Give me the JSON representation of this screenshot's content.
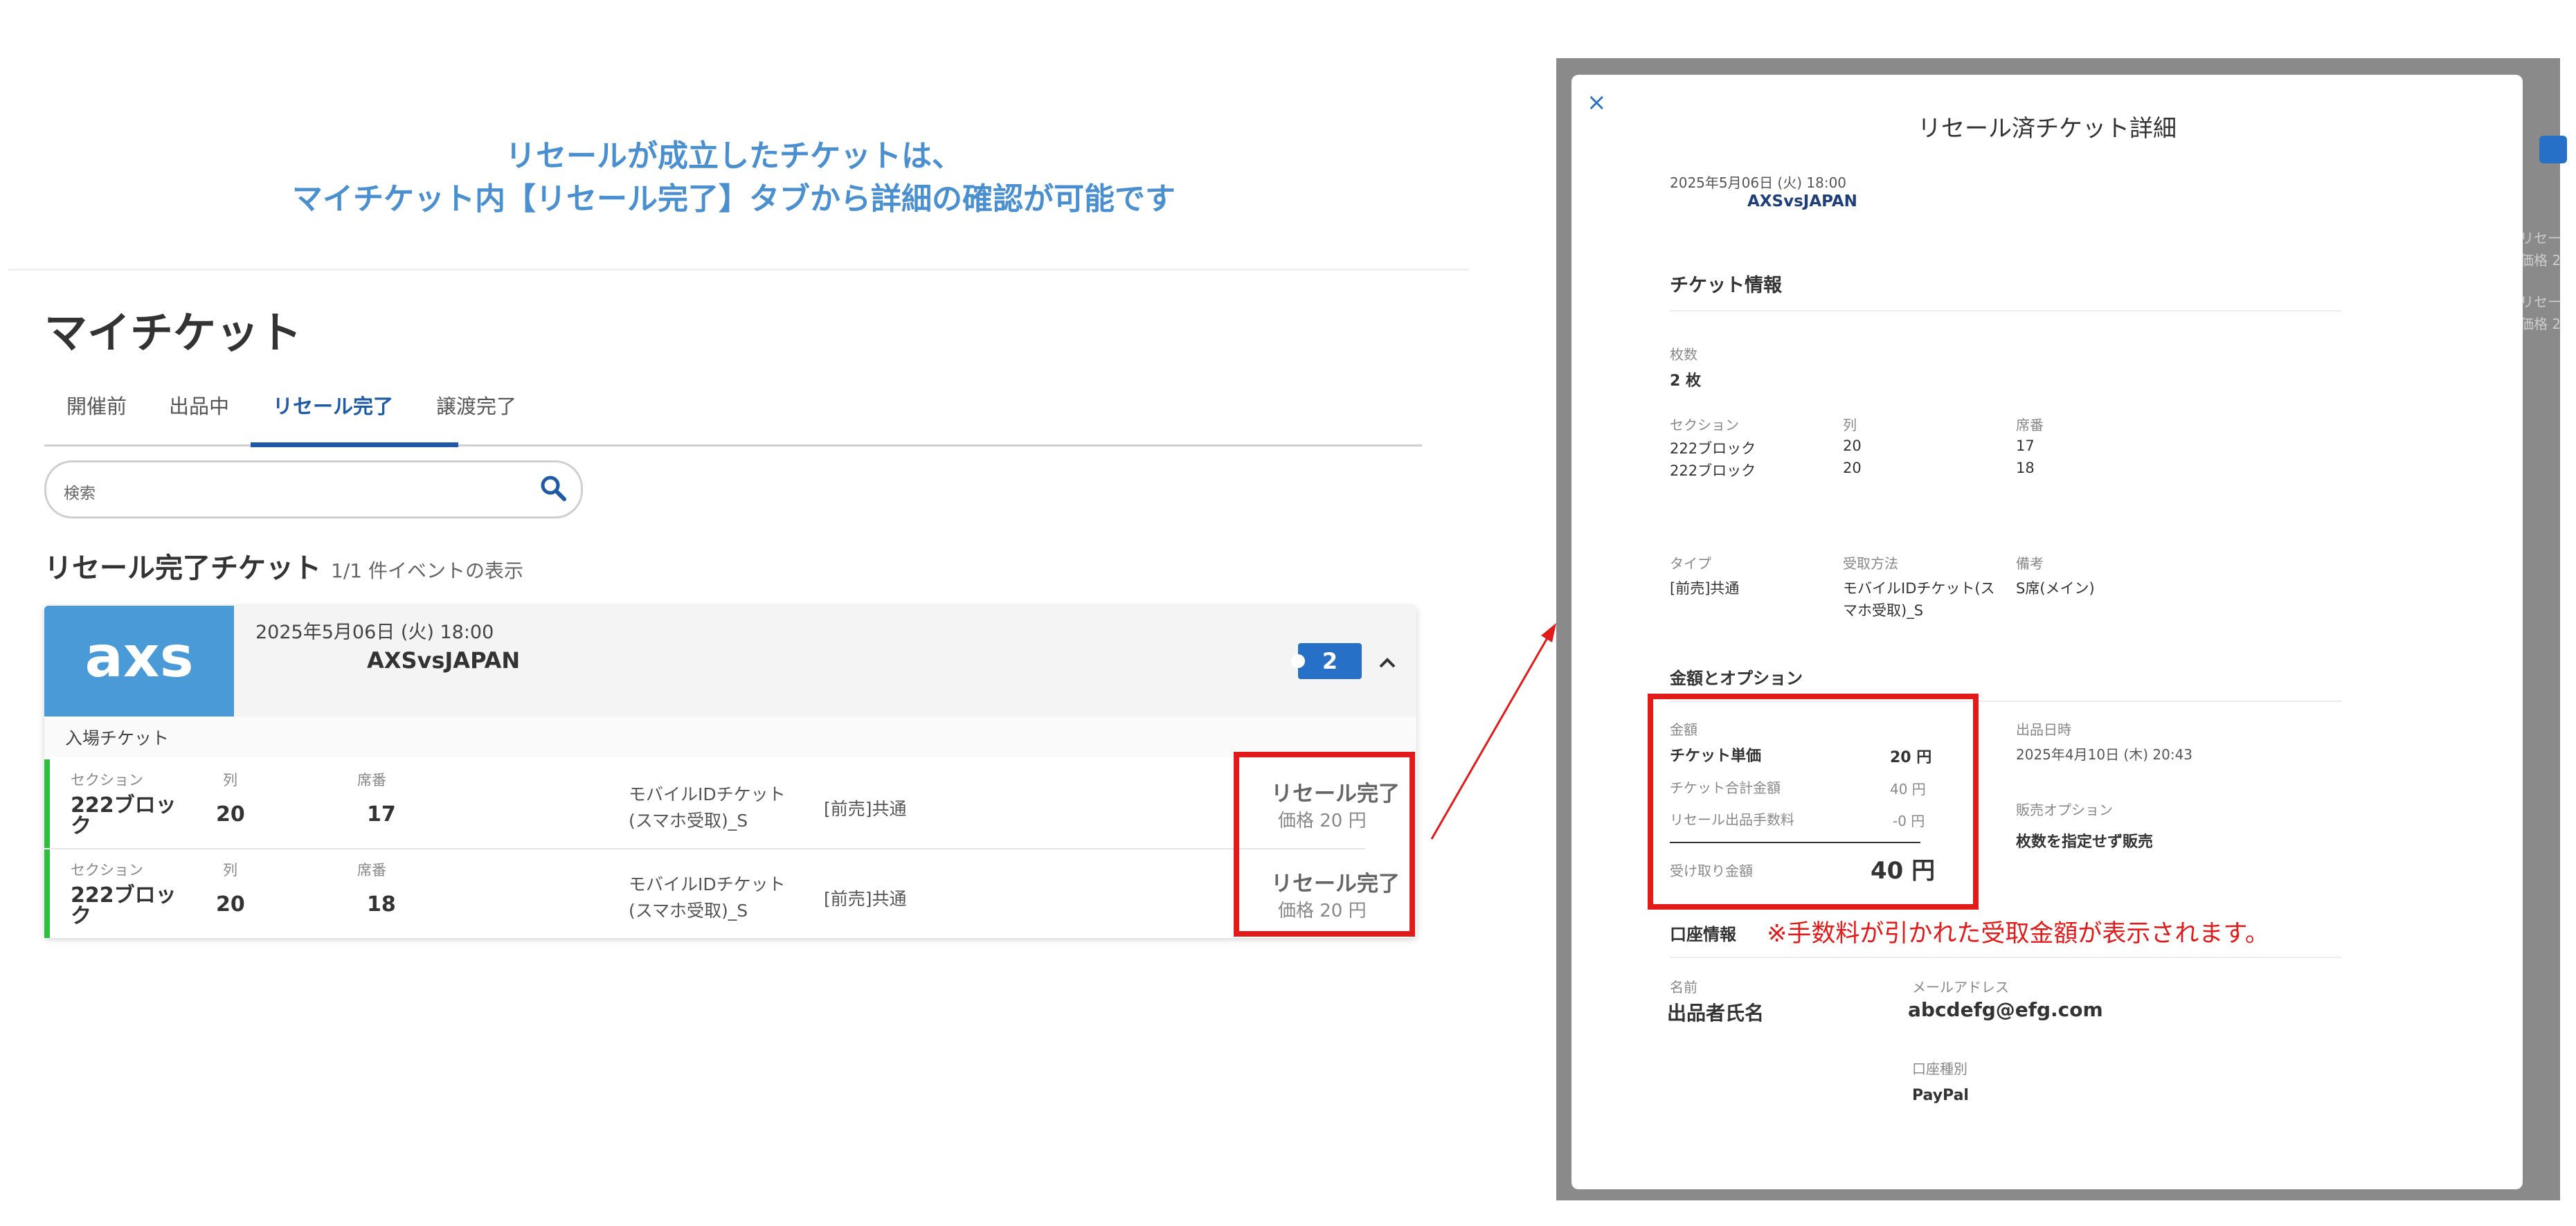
{
  "caption": {
    "line1": "リセールが成立したチケットは、",
    "line2": "マイチケット内【リセール完了】タブから詳細の確認が可能です"
  },
  "page": {
    "title": "マイチケット",
    "tabs": [
      {
        "label": "開催前"
      },
      {
        "label": "出品中"
      },
      {
        "label": "リセール完了"
      },
      {
        "label": "譲渡完了"
      }
    ],
    "active_tab": "リセール完了",
    "search_placeholder": "検索",
    "section_title": "リセール完了チケット",
    "section_count": "1/1 件イベントの表示"
  },
  "event": {
    "logo": "axs",
    "date": "2025年5月06日 (火) 18:00",
    "name": "AXSvsJAPAN",
    "qty": "2",
    "entry_label": "入場チケット"
  },
  "tickets": [
    {
      "section_label": "セクション",
      "section": "222ブロック",
      "row_label": "列",
      "row": "20",
      "seat_label": "席番",
      "seat": "17",
      "delivery": "モバイルIDチケット(スマホ受取)_S",
      "type": "[前売]共通",
      "status": "リセール完了",
      "price": "価格 20 円"
    },
    {
      "section_label": "セクション",
      "section": "222ブロック",
      "row_label": "列",
      "row": "20",
      "seat_label": "席番",
      "seat": "18",
      "delivery": "モバイルIDチケット(スマホ受取)_S",
      "type": "[前売]共通",
      "status": "リセール完了",
      "price": "価格 20 円"
    }
  ],
  "background_peek": {
    "line1": "リセー",
    "line2": "価格 2",
    "line3": "リセー",
    "line4": "価格 2"
  },
  "modal": {
    "close_icon": "×",
    "title": "リセール済チケット詳細",
    "event_date": "2025年5月06日 (火) 18:00",
    "event_name": "AXSvsJAPAN",
    "ticket_info_title": "チケット情報",
    "count_label": "枚数",
    "count_value": "2 枚",
    "section_label": "セクション",
    "row_label": "列",
    "seat_label": "席番",
    "seats": [
      {
        "section": "222ブロック",
        "row": "20",
        "seat": "17"
      },
      {
        "section": "222ブロック",
        "row": "20",
        "seat": "18"
      }
    ],
    "type_label": "タイプ",
    "type_value": "[前売]共通",
    "receive_label": "受取方法",
    "receive_value": "モバイルIDチケット(スマホ受取)_S",
    "note_label": "備考",
    "note_value": "S席(メイン)",
    "amount_title": "金額とオプション",
    "amount_label": "金額",
    "unit_price_label": "チケット単価",
    "unit_price_value": "20 円",
    "total_label": "チケット合計金額",
    "total_value": "40 円",
    "fee_label": "リセール出品手数料",
    "fee_value": "-0 円",
    "receive_amount_label": "受け取り金額",
    "receive_amount_value": "40 円",
    "listed_date_label": "出品日時",
    "listed_date_value": "2025年4月10日 (木) 20:43",
    "sale_option_label": "販売オプション",
    "sale_option_value": "枚数を指定せず販売",
    "account_title": "口座情報",
    "annotation": "※手数料が引かれた受取金額が表示されます。",
    "name_label": "名前",
    "name_value": "出品者氏名",
    "email_label": "メールアドレス",
    "email_value": "abcdefg@efg.com",
    "account_type_label": "口座種別",
    "account_type_value": "PayPal"
  },
  "colors": {
    "accent": "#1f5aa6",
    "caption": "#4a90d0",
    "highlight_red": "#e21a1a",
    "status_green": "#2dbd3f",
    "logo_blue": "#4a9ad8"
  }
}
